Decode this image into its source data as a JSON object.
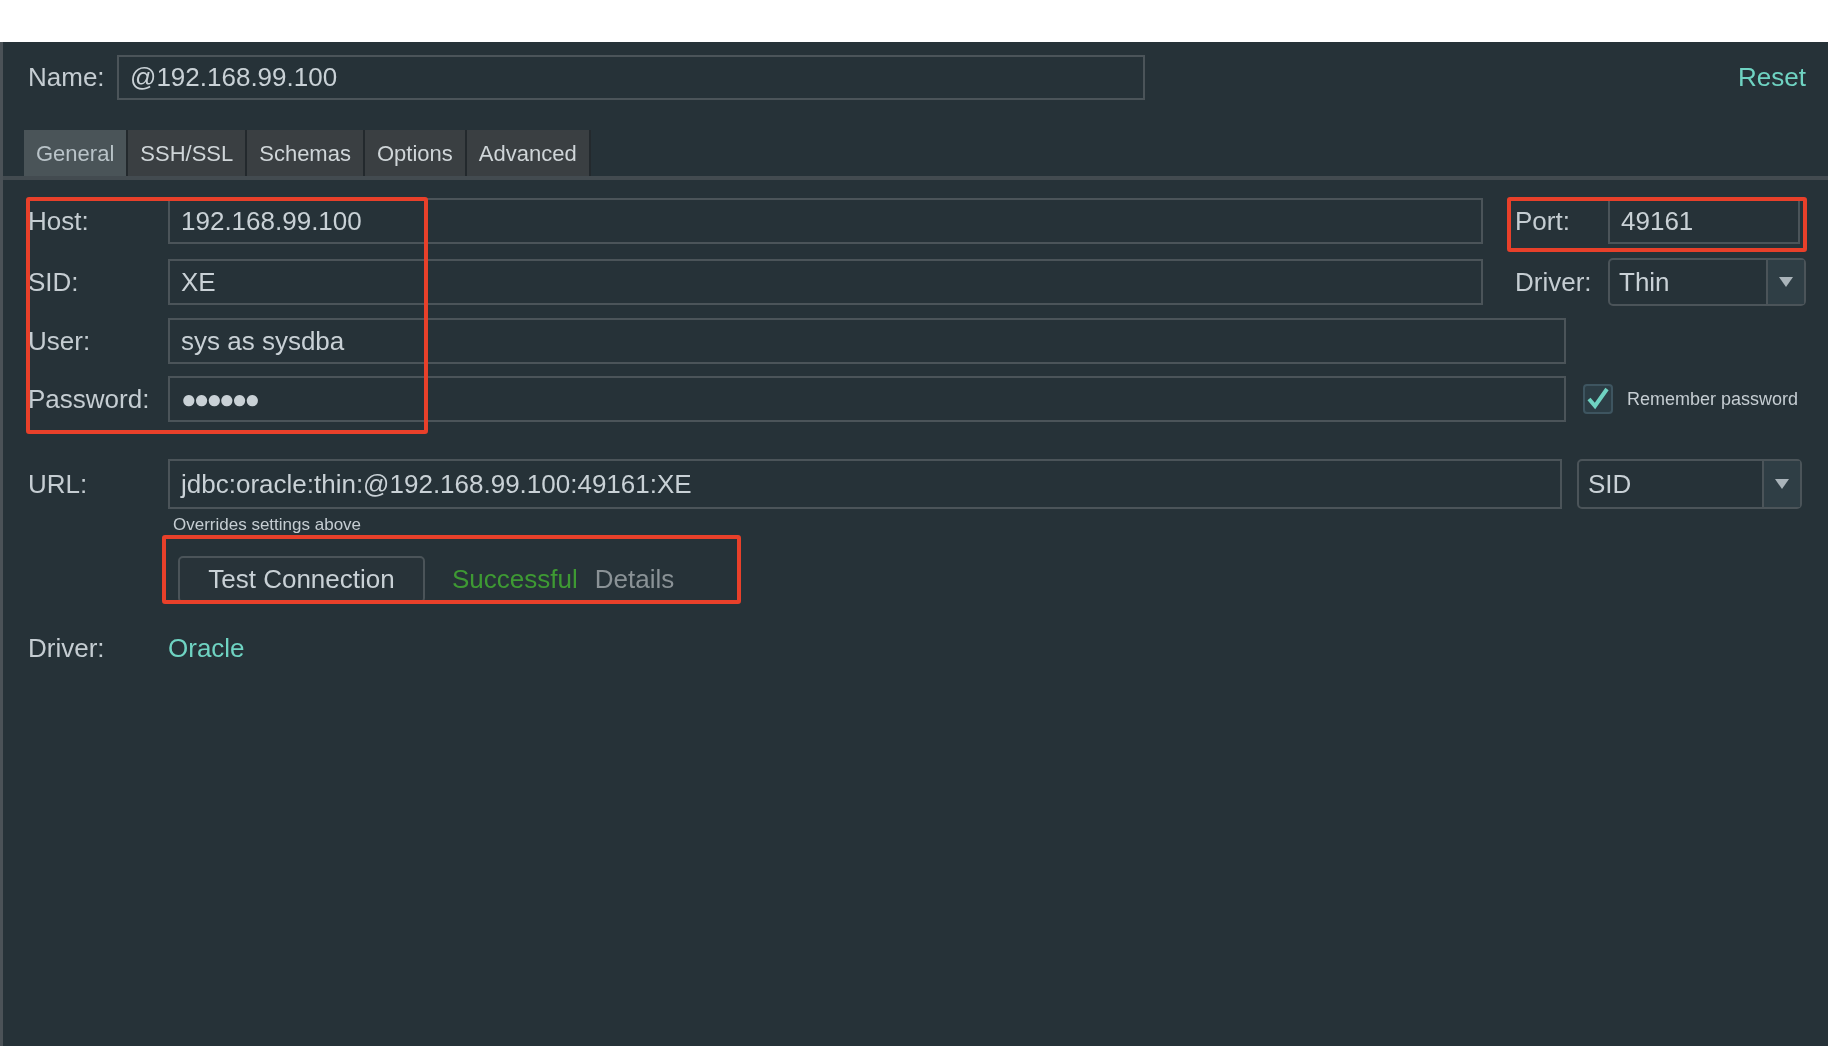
{
  "name_field": {
    "label": "Name:",
    "value": "@192.168.99.100"
  },
  "reset_link": "Reset",
  "tabs": [
    {
      "label": "General",
      "selected": true
    },
    {
      "label": "SSH/SSL",
      "selected": false
    },
    {
      "label": "Schemas",
      "selected": false
    },
    {
      "label": "Options",
      "selected": false
    },
    {
      "label": "Advanced",
      "selected": false
    }
  ],
  "host": {
    "label": "Host:",
    "value": "192.168.99.100"
  },
  "port": {
    "label": "Port:",
    "value": "49161"
  },
  "sid": {
    "label": "SID:",
    "value": "XE"
  },
  "driver_type": {
    "label": "Driver:",
    "value": "Thin"
  },
  "user": {
    "label": "User:",
    "value": "sys as sysdba"
  },
  "password": {
    "label": "Password:",
    "value": "●●●●●●"
  },
  "remember_password": {
    "label": "Remember password",
    "checked": true
  },
  "url": {
    "label": "URL:",
    "value": "jdbc:oracle:thin:@192.168.99.100:49161:XE",
    "hint": "Overrides settings above"
  },
  "url_type": {
    "value": "SID"
  },
  "test_connection": {
    "button": "Test Connection",
    "status": "Successful",
    "details": "Details"
  },
  "driver": {
    "label": "Driver:",
    "value": "Oracle"
  }
}
